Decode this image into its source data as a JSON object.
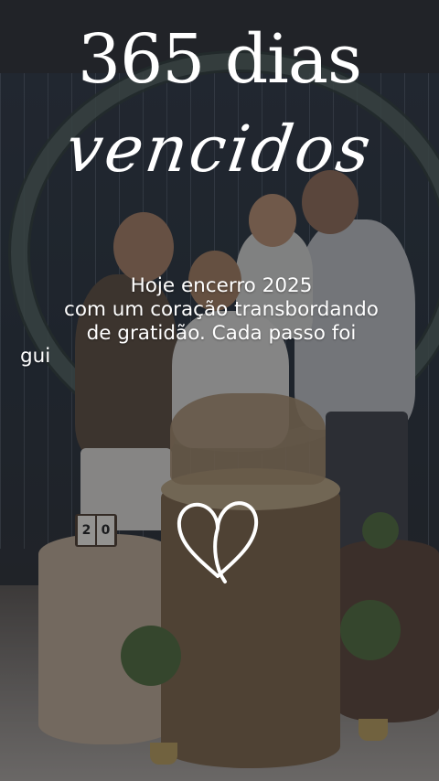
{
  "story": {
    "title": "365 dias",
    "script_title": "vencidos",
    "caption_lines": [
      "Hoje encerro 2025",
      "com um coração transbordando",
      "de gratidão. Cada passo foi",
      "gui"
    ],
    "calendar_digits": [
      "2",
      "0"
    ],
    "heart_icon": "heart-outline-icon",
    "text_color": "#ffffff"
  }
}
